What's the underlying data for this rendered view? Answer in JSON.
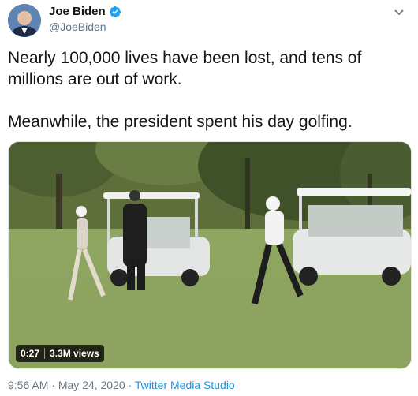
{
  "tweet": {
    "author_name": "Joe Biden",
    "author_handle": "@JoeBiden",
    "text_line_1": "Nearly 100,000 lives have been lost, and tens of millions are out of work.",
    "text_line_2": "Meanwhile, the president spent his day golfing.",
    "video_duration": "0:27",
    "video_views": "3.3M views",
    "time": "9:56 AM",
    "separator": " · ",
    "date": "May 24, 2020",
    "source": "Twitter Media Studio"
  },
  "colors": {
    "verified_badge": "#1da1f2",
    "link": "#1b95e0",
    "secondary_text": "#657786"
  },
  "icons": {
    "verified": "verified-badge-icon",
    "more": "chevron-down-icon"
  }
}
